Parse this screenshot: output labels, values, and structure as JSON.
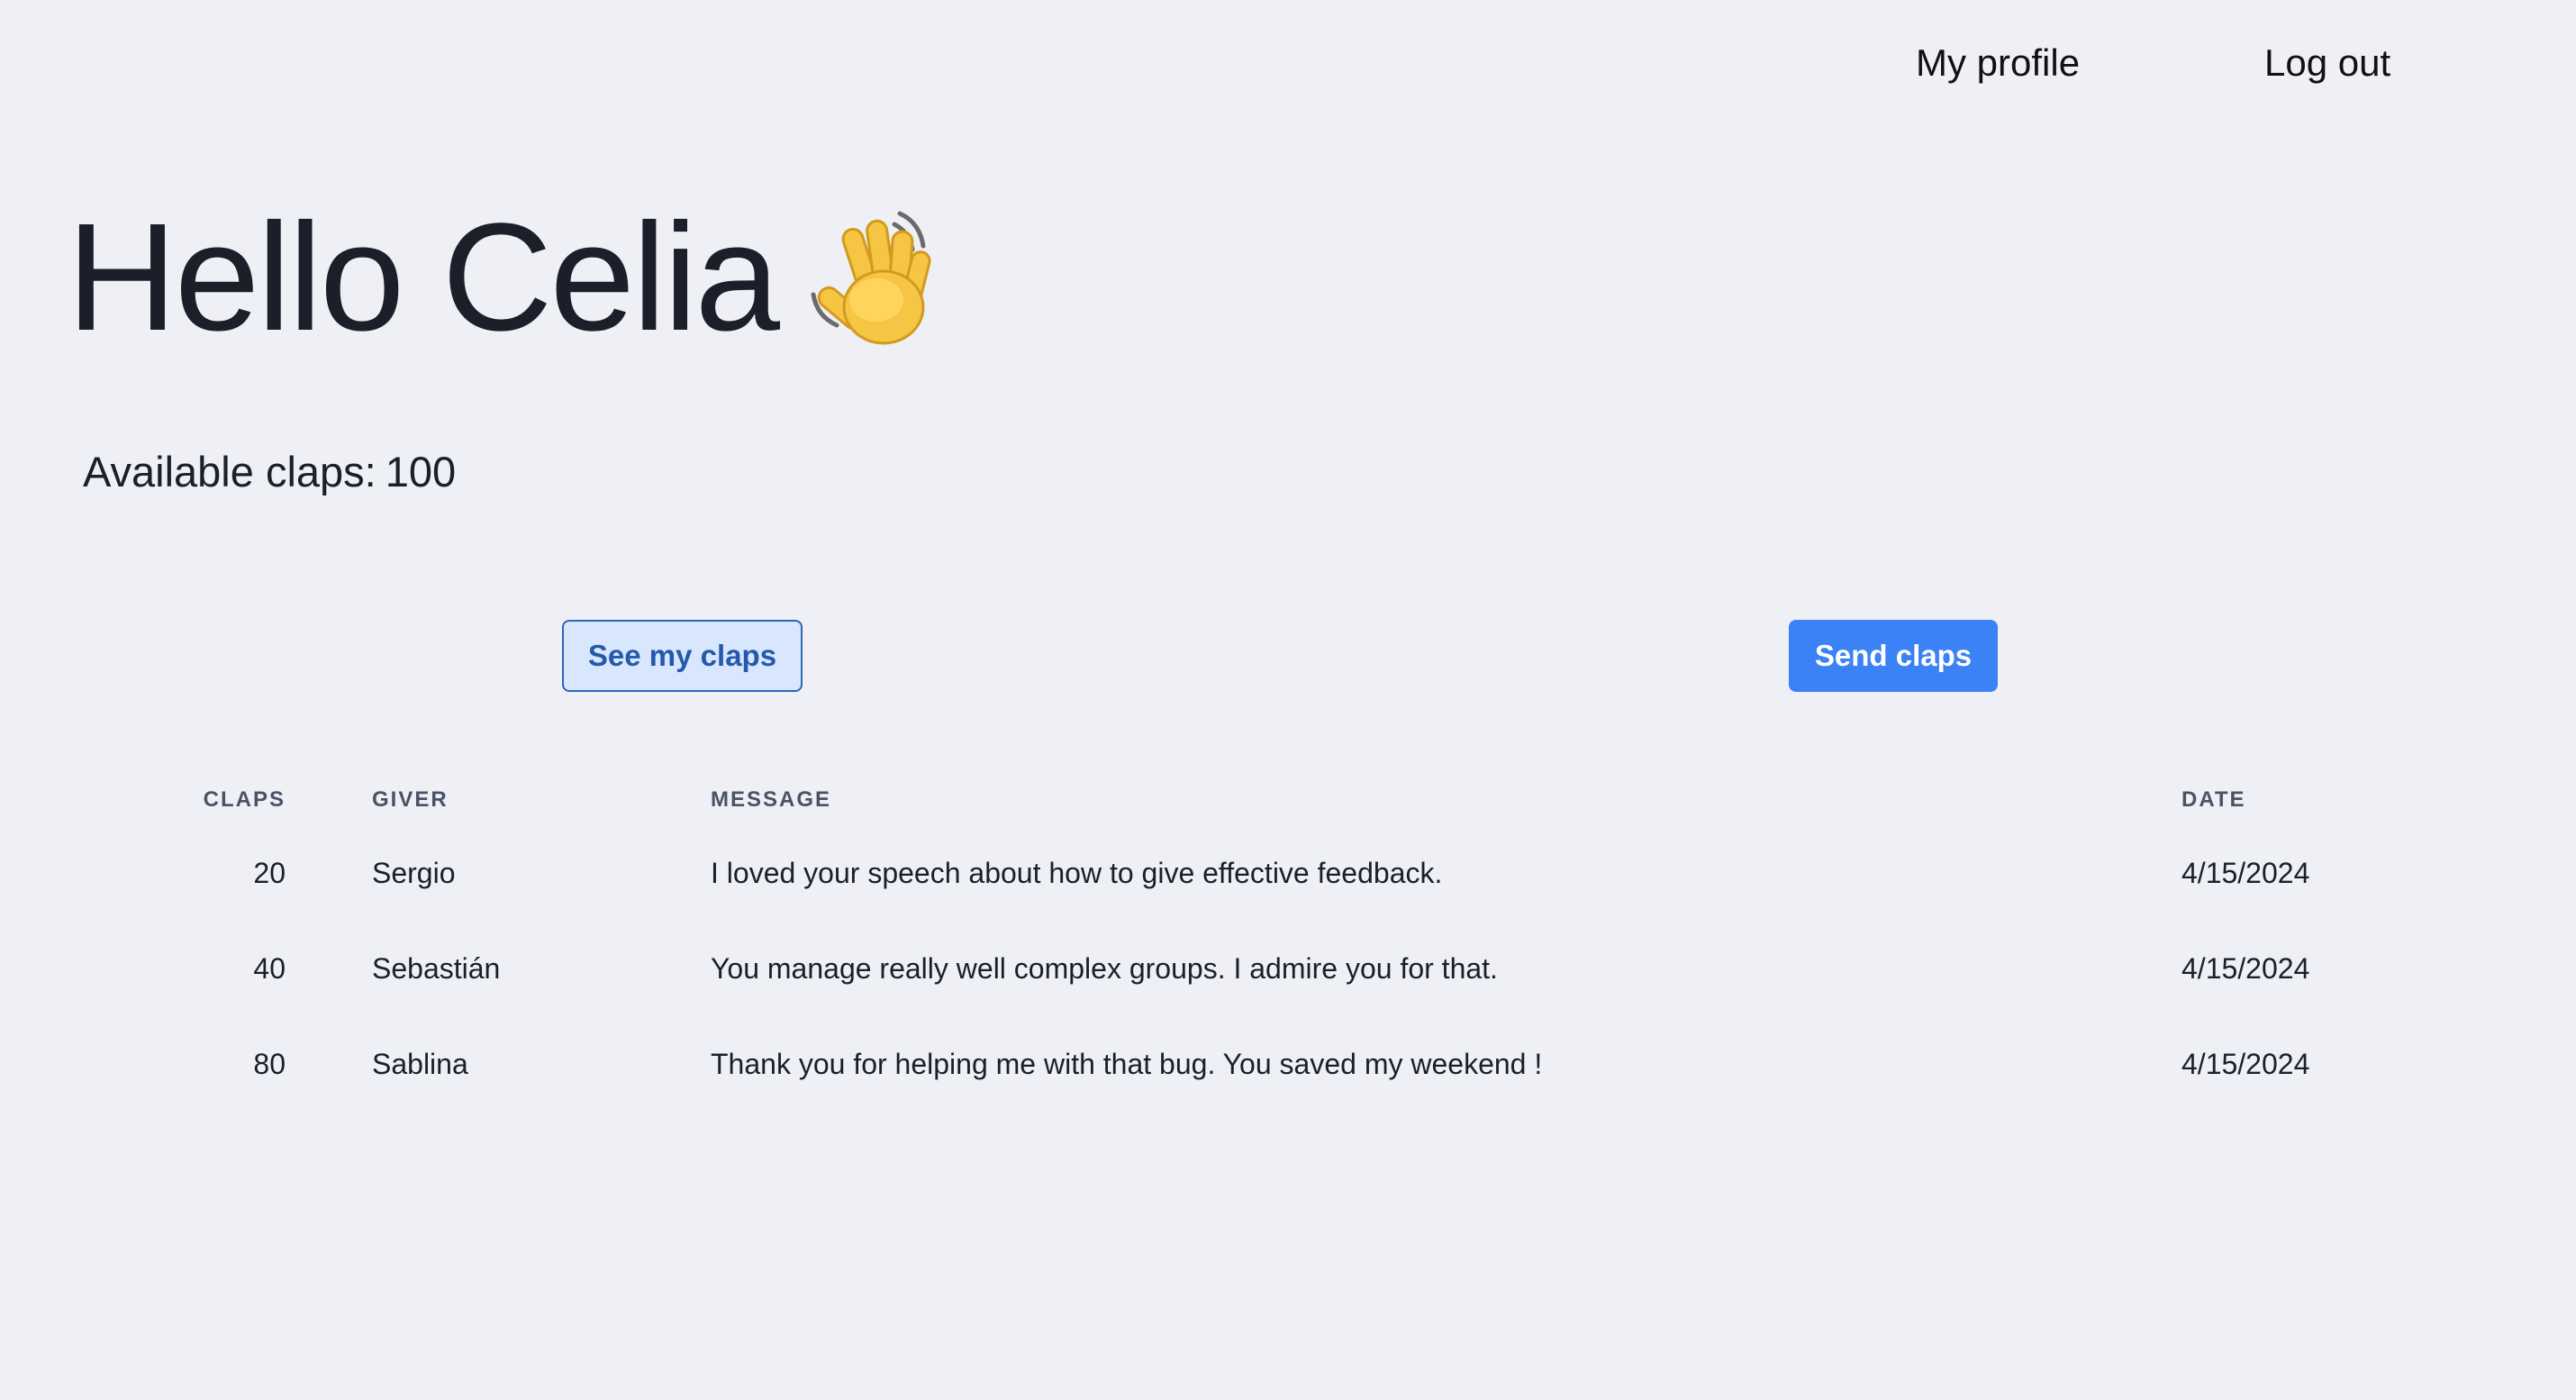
{
  "nav": {
    "profile_label": "My profile",
    "logout_label": "Log out"
  },
  "greeting": {
    "text": "Hello Celia",
    "icon": "waving-hand-icon"
  },
  "claps": {
    "available_label": "Available claps:",
    "available_value": "100"
  },
  "buttons": {
    "see_label": "See my claps",
    "send_label": "Send claps"
  },
  "table": {
    "headers": {
      "claps": "CLAPS",
      "giver": "GIVER",
      "message": "MESSAGE",
      "date": "DATE"
    },
    "rows": [
      {
        "claps": "20",
        "giver": "Sergio",
        "message": "I loved your speech about how to give effective feedback.",
        "date": "4/15/2024"
      },
      {
        "claps": "40",
        "giver": "Sebastián",
        "message": "You manage really well complex groups. I admire you for that.",
        "date": "4/15/2024"
      },
      {
        "claps": "80",
        "giver": "Sablina",
        "message": "Thank you for helping me with that bug. You saved my weekend !",
        "date": "4/15/2024"
      }
    ]
  },
  "colors": {
    "background": "#eff0f5",
    "primary": "#3b82f6",
    "secondary_bg": "#d8e7fd",
    "secondary_border": "#2d66b8"
  }
}
